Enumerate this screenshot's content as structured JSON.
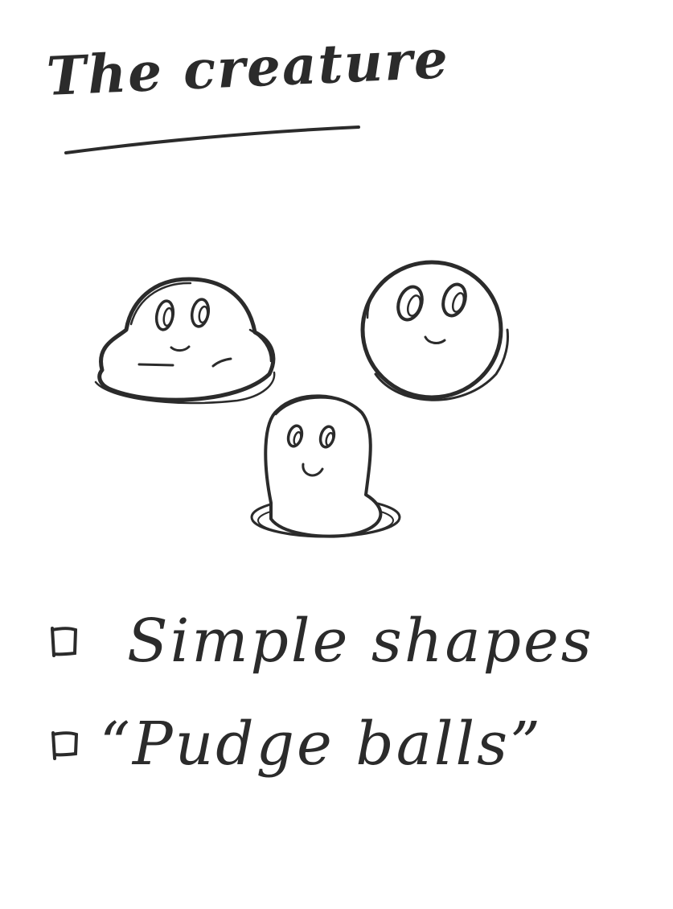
{
  "sketch": {
    "title": "The creature",
    "ink_color": "#2b2b2b",
    "background_color": "#ffffff",
    "checklist": [
      {
        "label": "Simple shapes",
        "checked": false
      },
      {
        "label": "“Pudge balls”",
        "checked": false
      }
    ]
  }
}
